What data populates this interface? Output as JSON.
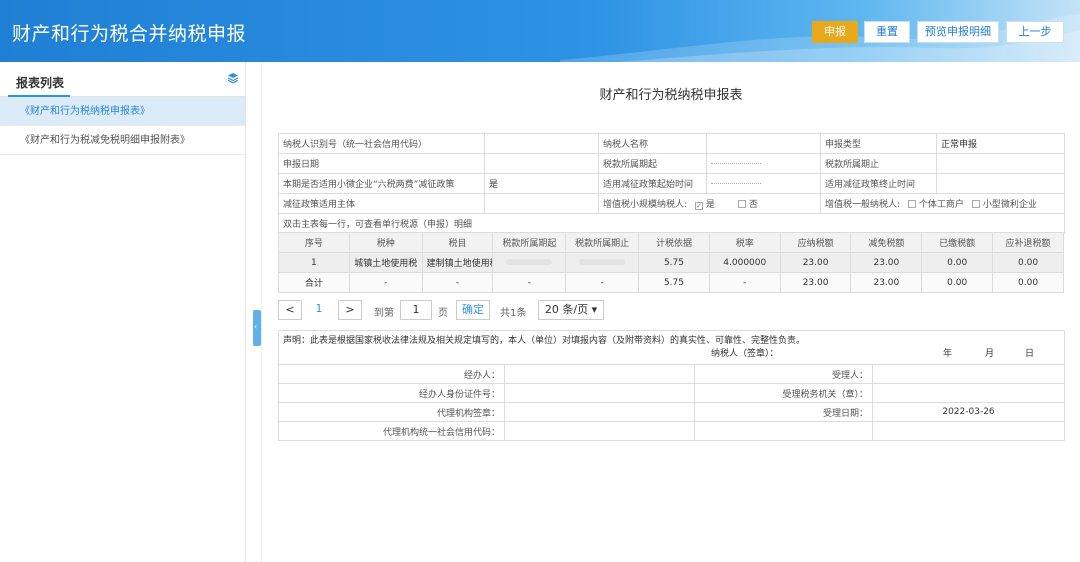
{
  "header": {
    "title": "财产和行为税合并纳税申报",
    "buttons": {
      "declare": "申报",
      "reset": "重置",
      "preview": "预览申报明细",
      "back": "上一步"
    }
  },
  "sidebar": {
    "title": "报表列表",
    "items": [
      {
        "label": "《财产和行为税纳税申报表》"
      },
      {
        "label": "《财产和行为税减免税明细申报附表》"
      }
    ]
  },
  "form": {
    "title": "财产和行为税纳税申报表",
    "info": {
      "taxpayer_id_label": "纳税人识别号（统一社会信用代码）",
      "taxpayer_name_label": "纳税人名称",
      "declare_type_label": "申报类型",
      "declare_type_value": "正常申报",
      "declare_date_label": "申报日期",
      "period_start_label": "税款所属期起",
      "period_end_label": "税款所属期止",
      "six_tax_label": "本期是否适用小微企业“六税两费”减征政策",
      "six_tax_value": "是",
      "policy_start_label": "适用减征政策起始时间",
      "policy_end_label": "适用减征政策终止时间",
      "policy_subject_label": "减征政策适用主体",
      "vat_small_label": "增值税小规模纳税人:",
      "yes": "是",
      "no": "否",
      "vat_general_label": "增值税一般纳税人:",
      "individual_label": "个体工商户",
      "micro_label": "小型微利企业",
      "hint": "双击主表每一行，可查看单行税源（申报）明细"
    },
    "grid": {
      "headers": [
        "序号",
        "税种",
        "税目",
        "税款所属期起",
        "税款所属期止",
        "计税依据",
        "税率",
        "应纳税额",
        "减免税额",
        "已缴税额",
        "应补退税额"
      ],
      "row": {
        "no": "1",
        "tax": "城镇土地使用税",
        "item": "建制镇土地使用税",
        "basis": "5.75",
        "rate": "4.000000",
        "payable": "23.00",
        "relief": "23.00",
        "paid": "0.00",
        "refund": "0.00"
      },
      "total": {
        "label": "合计",
        "dash": "-",
        "basis": "5.75",
        "payable": "23.00",
        "relief": "23.00",
        "paid": "0.00",
        "refund": "0.00"
      }
    },
    "pager": {
      "prev": "<",
      "current": "1",
      "next": ">",
      "goto": "到第",
      "page_input": "1",
      "page_unit": "页",
      "confirm": "确定",
      "total": "共1条",
      "page_size": "20 条/页 ▾"
    },
    "declaration": {
      "statement": "声明：此表是根据国家税收法律法规及相关规定填写的，本人（单位）对填报内容（及附带资料）的真实性、可靠性、完整性负责。",
      "taxpayer_sign": "纳税人（签章）：",
      "year": "年",
      "month": "月",
      "day": "日",
      "handler": "经办人：",
      "receiver": "受理人：",
      "handler_id": "经办人身份证件号：",
      "tax_office": "受理税务机关（章）：",
      "agency_seal": "代理机构签章：",
      "accept_date_label": "受理日期：",
      "accept_date": "2022-03-26",
      "agency_code": "代理机构统一社会信用代码："
    }
  },
  "colors": {
    "primary": "#2e93e4",
    "accent": "#e8a81c",
    "active_bg": "#dcebf8"
  }
}
